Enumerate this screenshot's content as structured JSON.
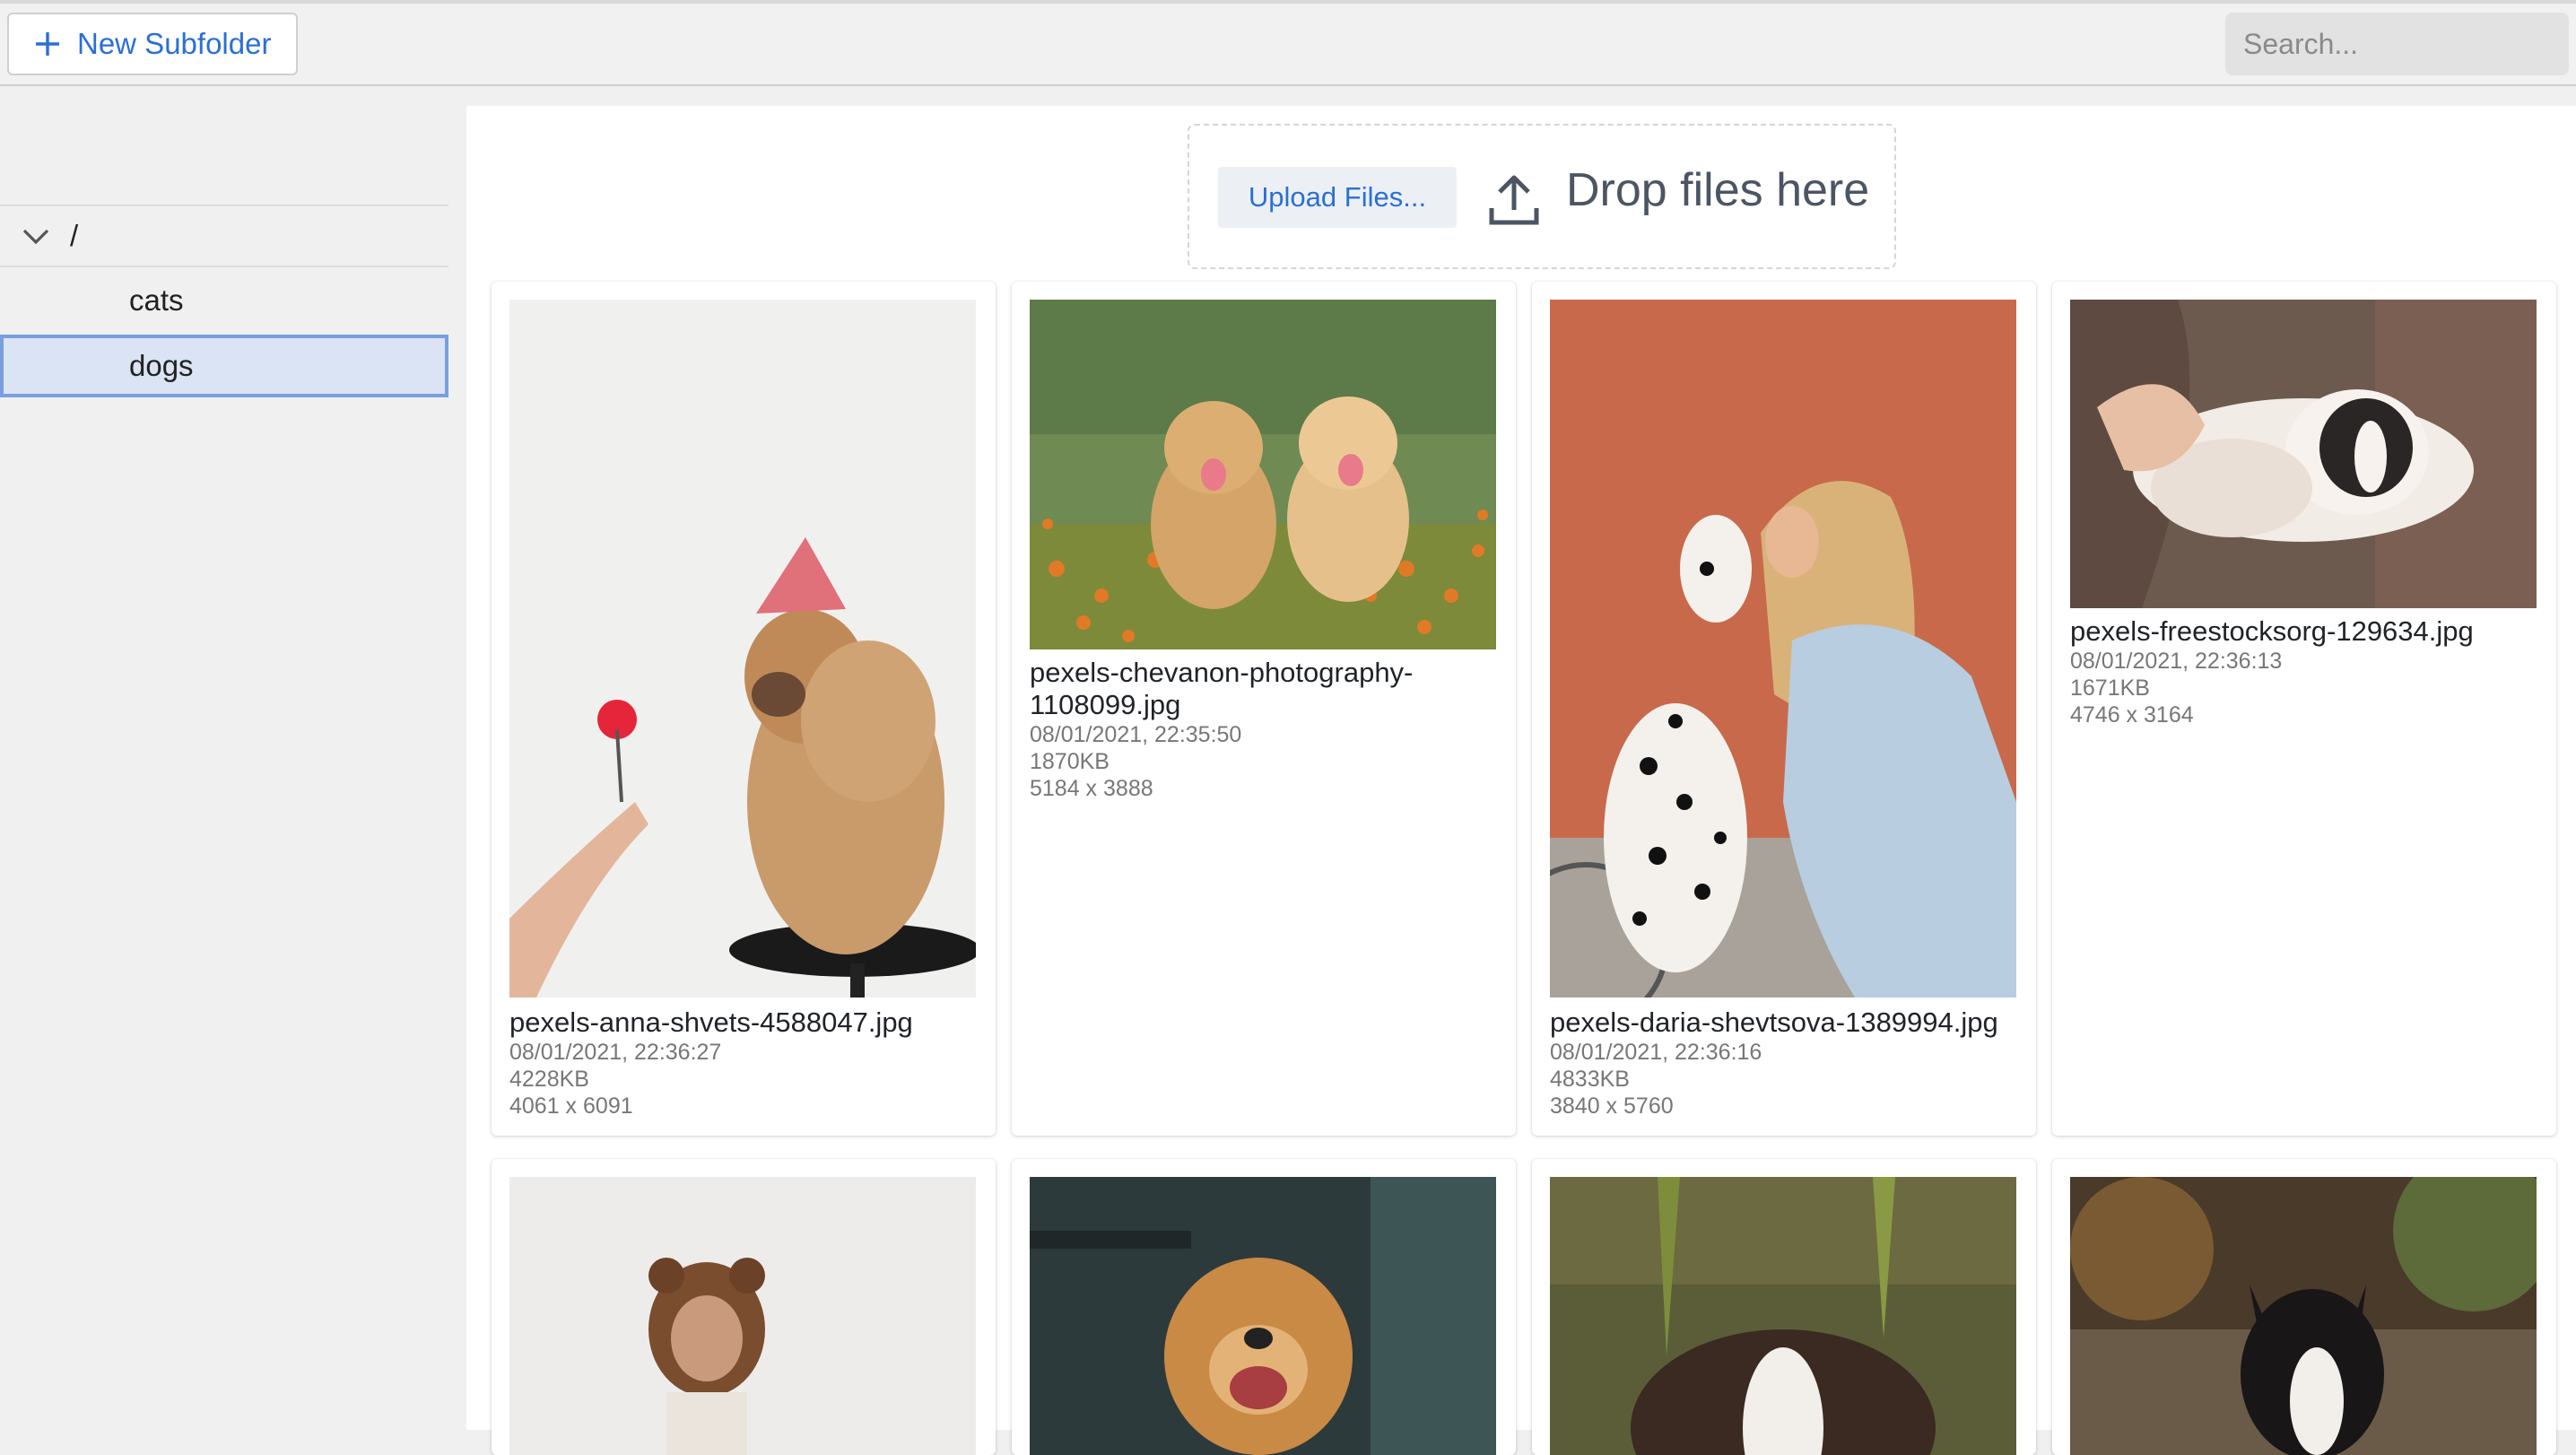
{
  "toolbar": {
    "new_subfolder_label": "New Subfolder",
    "search_placeholder": "Search..."
  },
  "sidebar": {
    "root_label": "/",
    "items": [
      {
        "label": "cats",
        "selected": false
      },
      {
        "label": "dogs",
        "selected": true
      }
    ]
  },
  "upload": {
    "button_label": "Upload Files...",
    "drop_text": "Drop files here"
  },
  "files": [
    {
      "name": "pexels-anna-shvets-4588047.jpg",
      "date": "08/01/2021, 22:36:27",
      "size": "4228KB",
      "dims": "4061 x 6091"
    },
    {
      "name": "pexels-chevanon-photography-1108099.jpg",
      "date": "08/01/2021, 22:35:50",
      "size": "1870KB",
      "dims": "5184 x 3888"
    },
    {
      "name": "pexels-daria-shevtsova-1389994.jpg",
      "date": "08/01/2021, 22:36:16",
      "size": "4833KB",
      "dims": "3840 x 5760"
    },
    {
      "name": "pexels-freestocksorg-129634.jpg",
      "date": "08/01/2021, 22:36:13",
      "size": "1671KB",
      "dims": "4746 x 3164"
    }
  ],
  "colors": {
    "accent": "#2b6fd6",
    "selected_bg": "#dbe4f4",
    "selected_border": "#7a9ee0"
  }
}
